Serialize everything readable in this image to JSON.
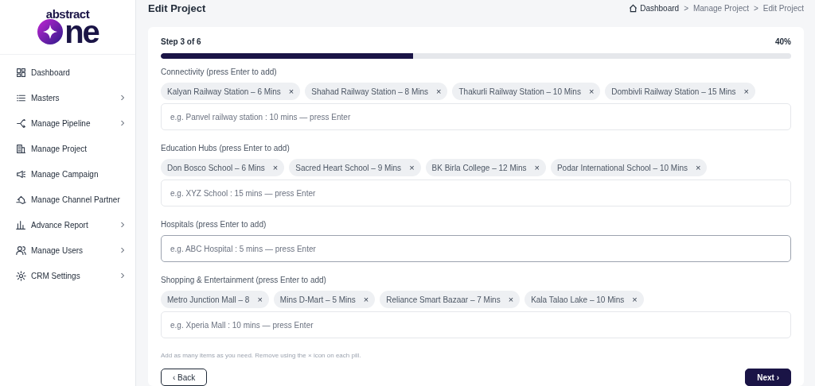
{
  "logo": {
    "top": "abstract",
    "word": "ne"
  },
  "sidebar": {
    "items": [
      {
        "label": "Dashboard",
        "expandable": false
      },
      {
        "label": "Masters",
        "expandable": true
      },
      {
        "label": "Manage Pipeline",
        "expandable": true
      },
      {
        "label": "Manage Project",
        "expandable": false
      },
      {
        "label": "Manage Campaign",
        "expandable": false
      },
      {
        "label": "Manage Channel Partner",
        "expandable": false
      },
      {
        "label": "Advance Report",
        "expandable": true
      },
      {
        "label": "Manage Users",
        "expandable": true
      },
      {
        "label": "CRM Settings",
        "expandable": true
      }
    ]
  },
  "page_title": "Edit Project",
  "breadcrumb": [
    {
      "label": "Dashboard"
    },
    {
      "separator": ">",
      "label": "Manage Project"
    },
    {
      "separator": ">",
      "label": "Edit Project"
    }
  ],
  "progress": {
    "step": "Step 3 of 6",
    "percent": "40%",
    "level": 0.4
  },
  "sections": [
    {
      "label": "Connectivity (press Enter to add)",
      "pills": [
        "Kalyan Railway Station – 6 Mins",
        "Shahad Railway Station – 8 Mins",
        "Thakurli Railway Station – 10 Mins",
        "Dombivli Railway Station – 15 Mins"
      ],
      "remove": "×",
      "placeholder": "e.g. Panvel railway station : 10 mins — press Enter",
      "focused": false
    },
    {
      "label": "Education Hubs (press Enter to add)",
      "pills": [
        "Don Bosco School – 6 Mins",
        "Sacred Heart School – 9 Mins",
        "BK Birla College – 12 Mins",
        "Podar International School – 10 Mins"
      ],
      "remove": "×",
      "placeholder": "e.g. XYZ School : 15 mins — press Enter",
      "focused": false
    },
    {
      "label": "Hospitals (press Enter to add)",
      "placeholder": "e.g. ABC Hospital : 5 mins — press Enter",
      "focused": true
    },
    {
      "label": "Shopping & Entertainment (press Enter to add)",
      "pills": [
        "Metro Junction Mall – 8",
        "Mins D-Mart – 5 Mins",
        "Reliance Smart Bazaar – 7 Mins",
        "Kala Talao Lake – 10 Mins"
      ],
      "remove": "×",
      "placeholder": "e.g. Xperia Mall : 10 mins — press Enter",
      "focused": false
    }
  ],
  "helper": "Add as many items as you need. Remove using the × icon on each pill.",
  "buttons": {
    "back": "‹ Back",
    "next": "Next ›"
  }
}
